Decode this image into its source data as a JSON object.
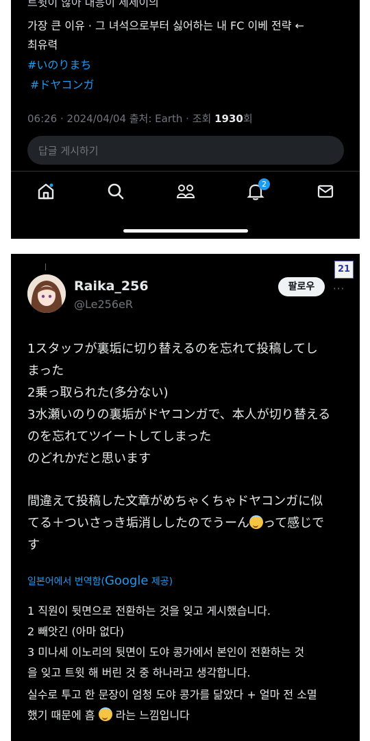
{
  "top": {
    "cut_line": "트윗이 않아 대응이 세세이의",
    "lines": [
      "가장 큰 이유 · 그 녀석으로부터 싫어하는 내 FC 이베 전략 ←",
      "최유력"
    ],
    "hashtags": [
      "#いのりまち",
      "#ドヤコンガ"
    ],
    "meta_prefix": "06:26 · 2024/04/04 출처: Earth · 조회 ",
    "meta_views": "1930",
    "meta_suffix": "회",
    "reply_placeholder": "답글 게시하기",
    "nav": [
      {
        "icon": "home-icon"
      },
      {
        "icon": "search-icon"
      },
      {
        "icon": "communities-icon"
      },
      {
        "icon": "notifications-icon",
        "badge": "2"
      },
      {
        "icon": "messages-icon"
      }
    ]
  },
  "bottom": {
    "page_badge": "21",
    "user": {
      "name": "Raika_256",
      "handle": "@Le256eR",
      "follow_label": "팔로우",
      "more": "···"
    },
    "jp_lines": [
      "1スタッフが裏垢に切り替えるのを忘れて投稿してし",
      "まった",
      "2乗っ取られた(多分ない)",
      "3水瀬いのりの裏垢がドヤコンガで、本人が切り替える",
      "のを忘れてツイートしてしまった",
      "のどれかだと思います",
      "",
      "間違えて投稿した文章がめちゃくちゃドヤコンガに似",
      "てる＋ついさっき垢消ししたのでうーん",
      "す"
    ],
    "jp_line9_suffix": "って感じで",
    "translate_prefix": "일본어에서 번역함(",
    "translate_google": "Google",
    "translate_suffix": " 제공)",
    "ko_lines": [
      "1 직원이 뒷면으로 전환하는 것을 잊고 게시했습니다.",
      "2 빼앗긴 (아마 없다)",
      "3 미나세 이노리의 뒷면이 도야 콩가에서 본인이 전환하는 것",
      "을 잊고 트윗 해 버린 것 중 하나라고 생각합니다.",
      "실수로 투고 한 문장이 엄청 도야 콩가를 닮았다 + 얼마 전 소멸",
      "했기 때문에 흠",
      "라는 느낌입니다"
    ],
    "colors": {
      "link": "#1d9bf0",
      "background": "#000000",
      "text": "#e7e9ea",
      "muted": "#71767b"
    }
  }
}
